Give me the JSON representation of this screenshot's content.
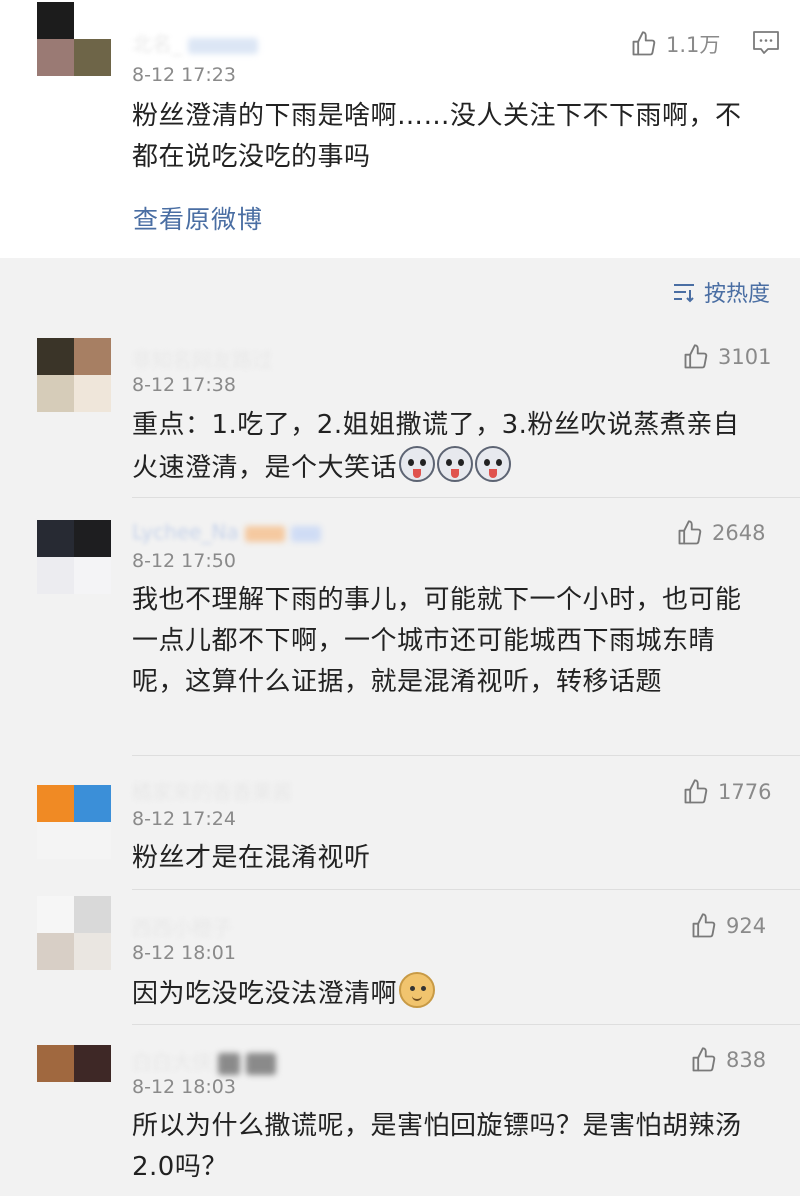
{
  "original_post": {
    "username": "北名_",
    "timestamp": "8-12 17:23",
    "likes": "1.1万",
    "content": "粉丝澄清的下雨是啥啊……没人关注下不下雨啊，不都在说吃没吃的事吗",
    "view_original": "查看原微博"
  },
  "sort": {
    "label": "按热度"
  },
  "comments": [
    {
      "username": "非知名网友路过",
      "timestamp": "8-12 17:38",
      "likes": "3101",
      "content": "重点：1.吃了，2.姐姐撒谎了，3.粉丝吹说蒸煮亲自火速澄清，是个大笑话"
    },
    {
      "username": "Lychee_Na",
      "timestamp": "8-12 17:50",
      "likes": "2648",
      "content": "我也不理解下雨的事儿，可能就下一个小时，也可能一点儿都不下啊，一个城市还可能城西下雨城东晴呢，这算什么证据，就是混淆视听，转移话题"
    },
    {
      "username": "橘家来的香香果酱",
      "timestamp": "8-12 17:24",
      "likes": "1776",
      "content": "粉丝才是在混淆视听"
    },
    {
      "username": "西西小橙子",
      "timestamp": "8-12 18:01",
      "likes": "924",
      "content": "因为吃没吃没法澄清啊"
    },
    {
      "username": "白白大侠",
      "timestamp": "8-12 18:03",
      "likes": "838",
      "content": "所以为什么撒谎呢，是害怕回旋镖吗？是害怕胡辣汤 2.0吗？"
    }
  ],
  "colors": {
    "link": "#4a6ea3",
    "meta": "#8a8a8a",
    "text": "#222222",
    "background": "#f2f2f2"
  },
  "icons": [
    "thumbs-up-icon",
    "comment-icon",
    "sort-icon",
    "husky-emoji",
    "doge-emoji"
  ]
}
